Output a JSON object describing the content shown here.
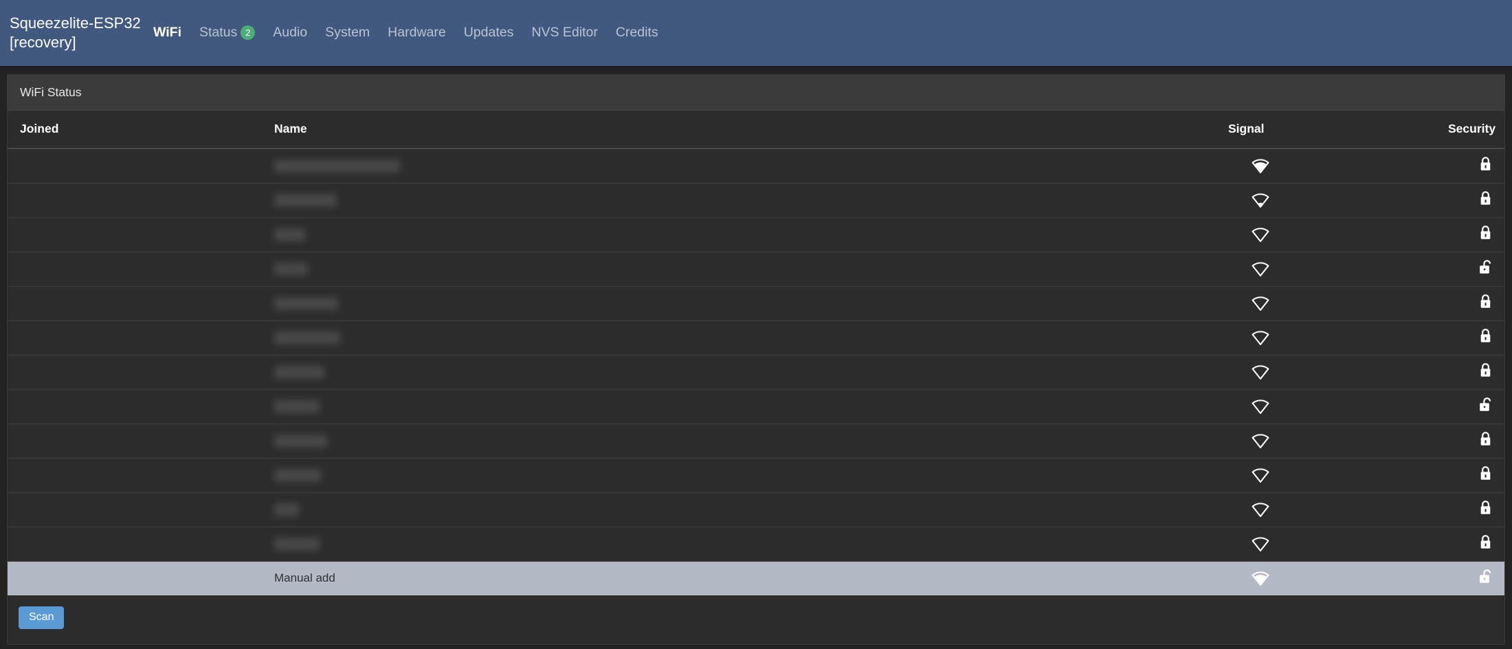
{
  "navbar": {
    "brand_line1": "Squeezelite-ESP32",
    "brand_line2": "[recovery]",
    "links": [
      {
        "label": "WiFi",
        "active": true,
        "badge": null
      },
      {
        "label": "Status",
        "active": false,
        "badge": "2"
      },
      {
        "label": "Audio",
        "active": false,
        "badge": null
      },
      {
        "label": "System",
        "active": false,
        "badge": null
      },
      {
        "label": "Hardware",
        "active": false,
        "badge": null
      },
      {
        "label": "Updates",
        "active": false,
        "badge": null
      },
      {
        "label": "NVS Editor",
        "active": false,
        "badge": null
      },
      {
        "label": "Credits",
        "active": false,
        "badge": null
      }
    ]
  },
  "panel": {
    "heading": "WiFi Status",
    "columns": {
      "joined": "Joined",
      "name": "Name",
      "signal": "Signal",
      "security": "Security"
    },
    "rows": [
      {
        "joined": "",
        "name": "",
        "name_redacted": true,
        "name_width": 183,
        "signal_level": 4,
        "secured": true,
        "signal_icon": "wifi-icon",
        "security_icon": "lock-closed-icon"
      },
      {
        "joined": "",
        "name": "",
        "name_redacted": true,
        "name_width": 91,
        "signal_level": 2,
        "secured": true,
        "signal_icon": "wifi-icon",
        "security_icon": "lock-closed-icon"
      },
      {
        "joined": "",
        "name": "",
        "name_redacted": true,
        "name_width": 45,
        "signal_level": 1,
        "secured": true,
        "signal_icon": "wifi-icon",
        "security_icon": "lock-closed-icon"
      },
      {
        "joined": "",
        "name": "",
        "name_redacted": true,
        "name_width": 49,
        "signal_level": 1,
        "secured": false,
        "signal_icon": "wifi-icon",
        "security_icon": "lock-open-icon"
      },
      {
        "joined": "",
        "name": "",
        "name_redacted": true,
        "name_width": 93,
        "signal_level": 1,
        "secured": true,
        "signal_icon": "wifi-icon",
        "security_icon": "lock-closed-icon"
      },
      {
        "joined": "",
        "name": "",
        "name_redacted": true,
        "name_width": 96,
        "signal_level": 1,
        "secured": true,
        "signal_icon": "wifi-icon",
        "security_icon": "lock-closed-icon"
      },
      {
        "joined": "",
        "name": "",
        "name_redacted": true,
        "name_width": 73,
        "signal_level": 1,
        "secured": true,
        "signal_icon": "wifi-icon",
        "security_icon": "lock-closed-icon"
      },
      {
        "joined": "",
        "name": "",
        "name_redacted": true,
        "name_width": 66,
        "signal_level": 1,
        "secured": false,
        "signal_icon": "wifi-icon",
        "security_icon": "lock-open-icon"
      },
      {
        "joined": "",
        "name": "",
        "name_redacted": true,
        "name_width": 77,
        "signal_level": 1,
        "secured": true,
        "signal_icon": "wifi-icon",
        "security_icon": "lock-closed-icon"
      },
      {
        "joined": "",
        "name": "",
        "name_redacted": true,
        "name_width": 68,
        "signal_level": 1,
        "secured": true,
        "signal_icon": "wifi-icon",
        "security_icon": "lock-closed-icon"
      },
      {
        "joined": "",
        "name": "",
        "name_redacted": true,
        "name_width": 36,
        "signal_level": 1,
        "secured": true,
        "signal_icon": "wifi-icon",
        "security_icon": "lock-closed-icon"
      },
      {
        "joined": "",
        "name": "",
        "name_redacted": true,
        "name_width": 66,
        "signal_level": 1,
        "secured": true,
        "signal_icon": "wifi-icon",
        "security_icon": "lock-closed-icon"
      }
    ],
    "manual_row": {
      "joined": "",
      "name": "Manual add",
      "signal_level": 4,
      "secured": false,
      "signal_icon": "wifi-icon",
      "security_icon": "lock-open-icon"
    }
  },
  "footer": {
    "scan_label": "Scan"
  },
  "colors": {
    "navbar_bg": "#41597f",
    "page_bg": "#222222",
    "panel_bg": "#2c2c2c",
    "panel_heading_bg": "#3b3b3b",
    "badge_green": "#4cae79",
    "scan_blue": "#5b9bd5",
    "manual_row_bg": "#b3bac6"
  }
}
